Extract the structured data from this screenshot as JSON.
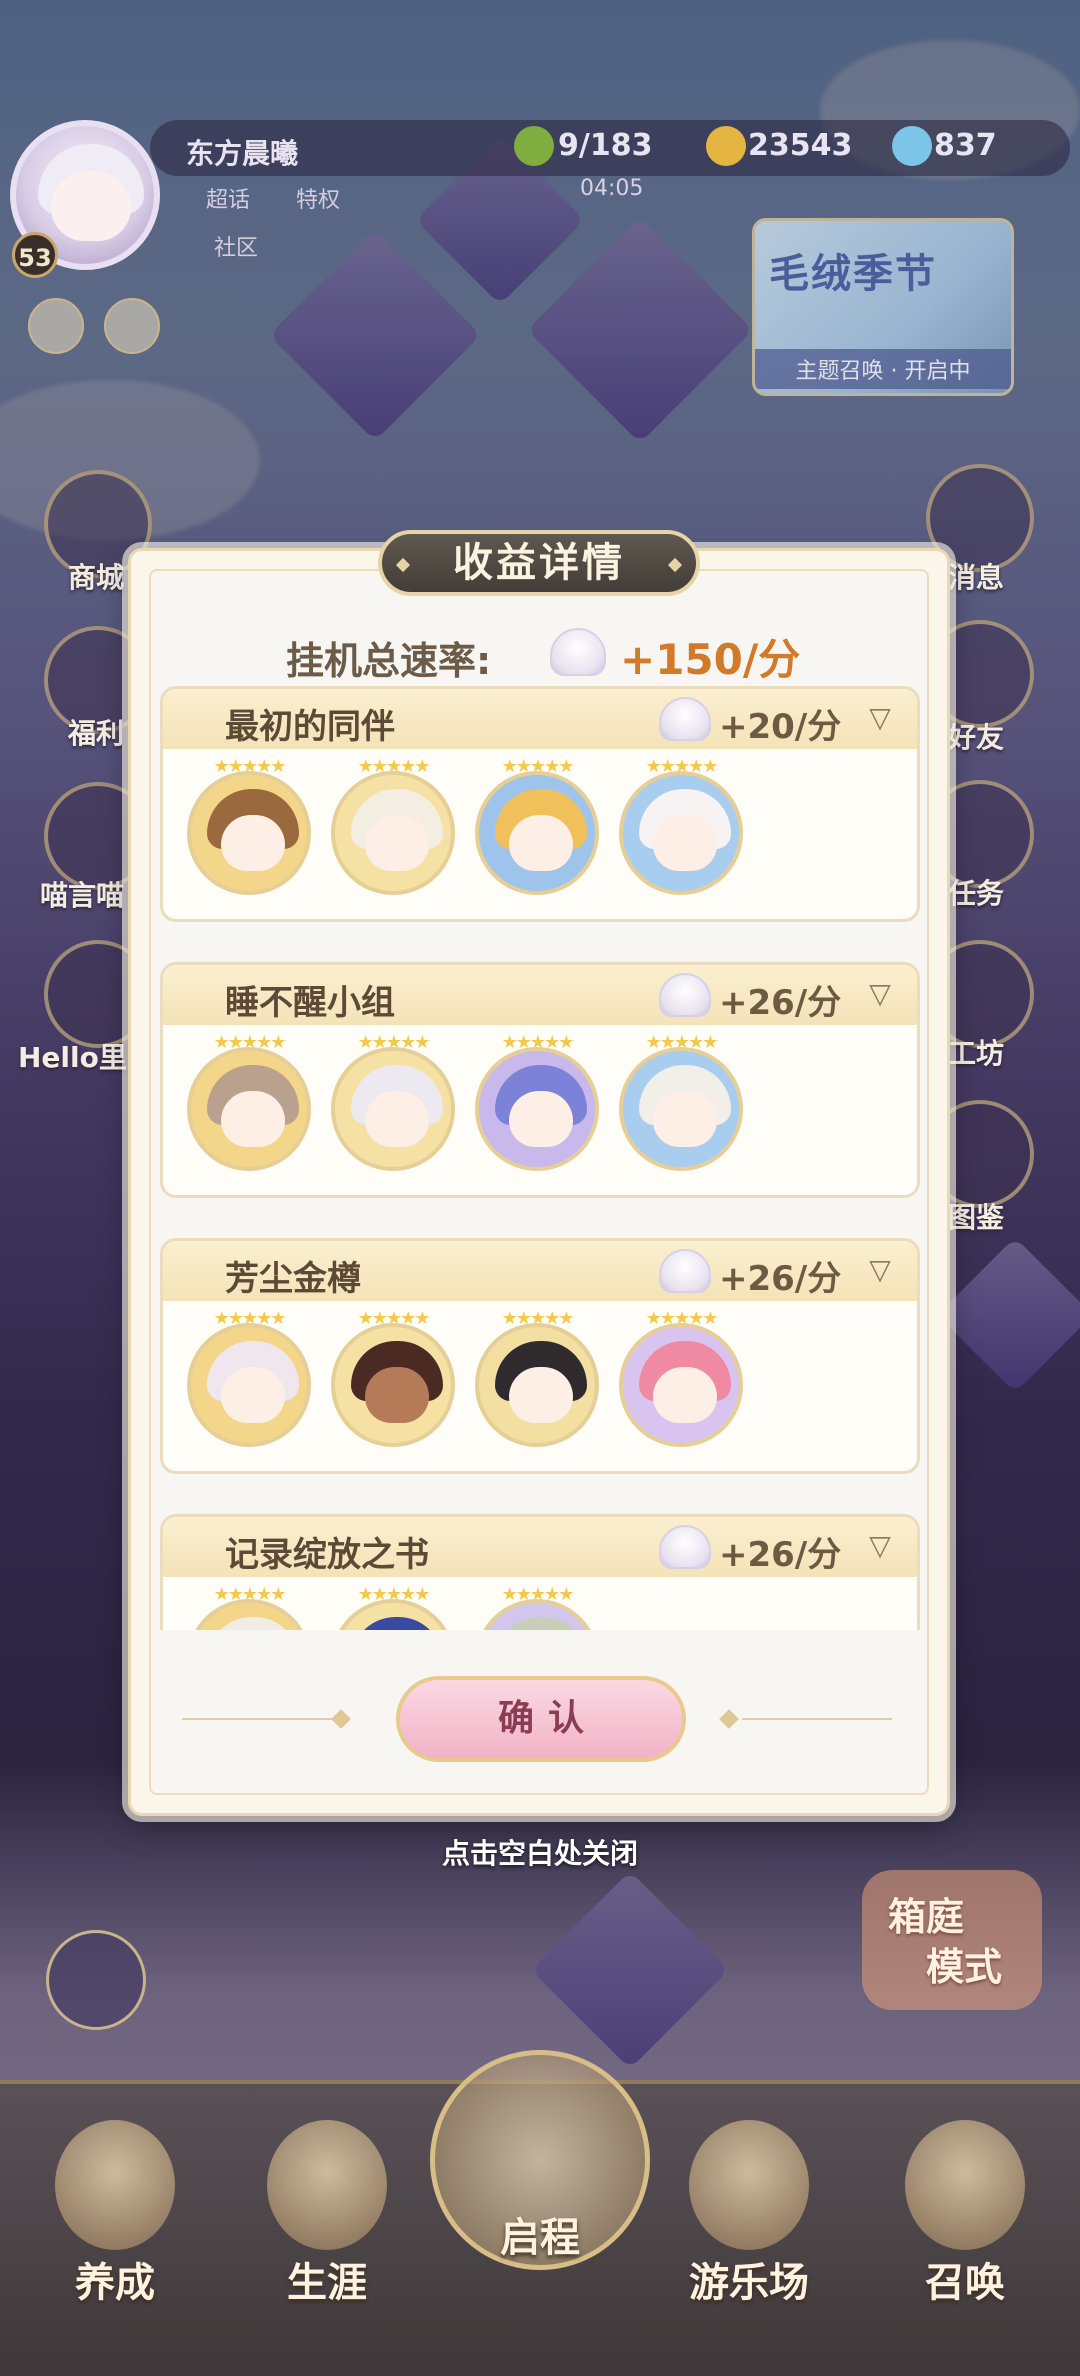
{
  "player": {
    "name": "东方晨曦",
    "level": "53",
    "tag_1": "超话",
    "tag_2": "特权",
    "tag_3": "社区"
  },
  "resources": {
    "clover": "9/183",
    "coin": "23543",
    "gem": "837",
    "timer": "04:05"
  },
  "banner": {
    "title": "毛绒季节",
    "subtitle": "主题召唤 · 开启中"
  },
  "side_left": [
    "商城",
    "福利",
    "喵言喵",
    "Hello里"
  ],
  "side_right": [
    "消息",
    "好友",
    "任务",
    "工坊",
    "图鉴"
  ],
  "modal": {
    "title": "收益详情",
    "total_label": "挂机总速率:",
    "total_value": "+150/分",
    "groups": [
      {
        "name": "最初的同伴",
        "rate": "+20/分"
      },
      {
        "name": "睡不醒小组",
        "rate": "+26/分"
      },
      {
        "name": "芳尘金樽",
        "rate": "+26/分"
      },
      {
        "name": "记录绽放之书",
        "rate": "+26/分"
      }
    ],
    "confirm": "确认",
    "close_hint": "点击空白处关闭",
    "arrow": "▽",
    "stars": "★★★★★"
  },
  "garden": [
    "箱庭",
    "模式"
  ],
  "nav": [
    "养成",
    "生涯",
    "启程",
    "游乐场",
    "召唤"
  ],
  "colors": {
    "accent_gold": "#e6cf97",
    "rate_orange": "#d07a2a",
    "confirm_pink": "#f1b3c7"
  }
}
